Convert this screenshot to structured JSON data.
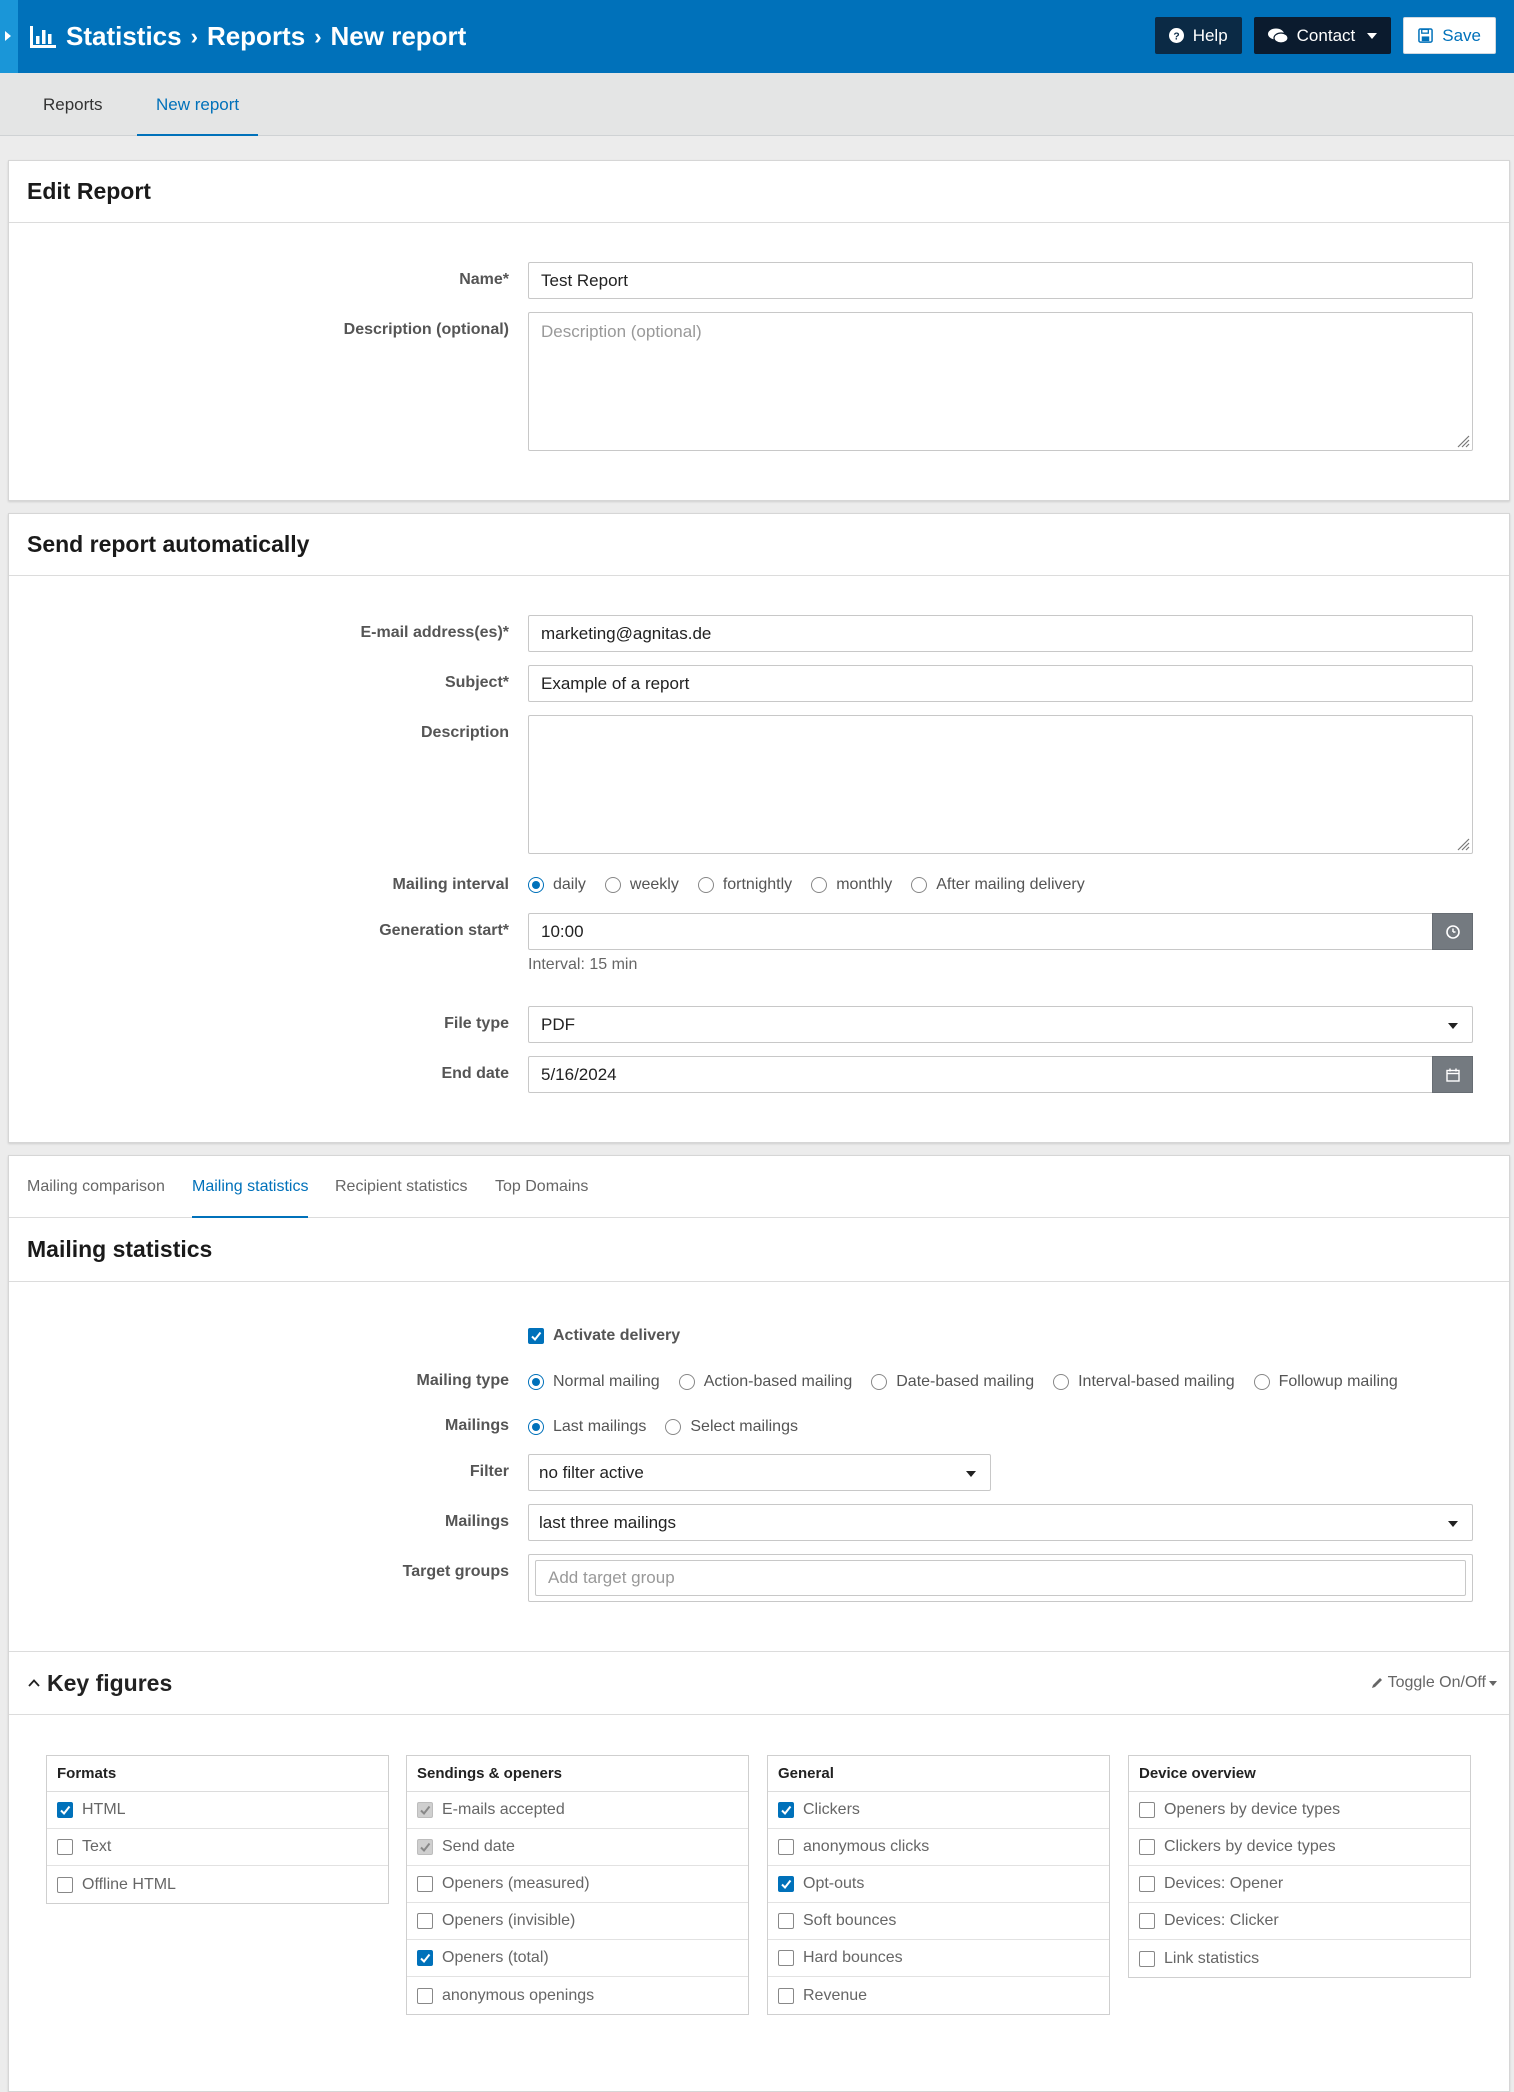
{
  "header": {
    "breadcrumb": [
      "Statistics",
      "Reports",
      "New report"
    ],
    "help_label": "Help",
    "contact_label": "Contact",
    "save_label": "Save"
  },
  "tabs": [
    {
      "label": "Reports",
      "active": false
    },
    {
      "label": "New report",
      "active": true
    }
  ],
  "edit_report": {
    "title": "Edit Report",
    "name_label": "Name*",
    "name_value": "Test Report",
    "description_label": "Description (optional)",
    "description_placeholder": "Description (optional)"
  },
  "send_auto": {
    "title": "Send report automatically",
    "email_label": "E-mail address(es)*",
    "email_value": "marketing@agnitas.de",
    "subject_label": "Subject*",
    "subject_value": "Example of a report",
    "description_label": "Description",
    "description_value": "",
    "interval_label": "Mailing interval",
    "interval_options": [
      "daily",
      "weekly",
      "fortnightly",
      "monthly",
      "After mailing delivery"
    ],
    "interval_selected": "daily",
    "generation_label": "Generation start*",
    "generation_value": "10:00",
    "interval_help": "Interval: 15 min",
    "filetype_label": "File type",
    "filetype_value": "PDF",
    "enddate_label": "End date",
    "enddate_value": "5/16/2024"
  },
  "stats_tabs": [
    {
      "label": "Mailing comparison",
      "active": false
    },
    {
      "label": "Mailing statistics",
      "active": true
    },
    {
      "label": "Recipient statistics",
      "active": false
    },
    {
      "label": "Top Domains",
      "active": false
    }
  ],
  "mailing_stats": {
    "title": "Mailing statistics",
    "activate_label": "Activate delivery",
    "activate_checked": true,
    "type_label": "Mailing type",
    "type_options": [
      "Normal mailing",
      "Action-based mailing",
      "Date-based mailing",
      "Interval-based mailing",
      "Followup mailing"
    ],
    "type_selected": "Normal mailing",
    "mailings_label": "Mailings",
    "mailings_options": [
      "Last mailings",
      "Select mailings"
    ],
    "mailings_selected": "Last mailings",
    "filter_label": "Filter",
    "filter_value": "no filter active",
    "mailings2_label": "Mailings",
    "mailings2_value": "last three mailings",
    "target_label": "Target groups",
    "target_placeholder": "Add target group"
  },
  "key_figures": {
    "title": "Key figures",
    "toggle_label": "Toggle On/Off",
    "groups": [
      {
        "title": "Formats",
        "items": [
          {
            "label": "HTML",
            "state": "checked"
          },
          {
            "label": "Text",
            "state": "unchecked"
          },
          {
            "label": "Offline HTML",
            "state": "unchecked"
          }
        ]
      },
      {
        "title": "Sendings & openers",
        "items": [
          {
            "label": "E-mails accepted",
            "state": "disabled"
          },
          {
            "label": "Send date",
            "state": "disabled"
          },
          {
            "label": "Openers (measured)",
            "state": "unchecked"
          },
          {
            "label": "Openers (invisible)",
            "state": "unchecked"
          },
          {
            "label": "Openers (total)",
            "state": "checked"
          },
          {
            "label": "anonymous openings",
            "state": "unchecked"
          }
        ]
      },
      {
        "title": "General",
        "items": [
          {
            "label": "Clickers",
            "state": "checked"
          },
          {
            "label": "anonymous clicks",
            "state": "unchecked"
          },
          {
            "label": "Opt-outs",
            "state": "checked"
          },
          {
            "label": "Soft bounces",
            "state": "unchecked"
          },
          {
            "label": "Hard bounces",
            "state": "unchecked"
          },
          {
            "label": "Revenue",
            "state": "unchecked"
          }
        ]
      },
      {
        "title": "Device overview",
        "items": [
          {
            "label": "Openers by device types",
            "state": "unchecked"
          },
          {
            "label": "Clickers by device types",
            "state": "unchecked"
          },
          {
            "label": "Devices: Opener",
            "state": "unchecked"
          },
          {
            "label": "Devices: Clicker",
            "state": "unchecked"
          },
          {
            "label": "Link statistics",
            "state": "unchecked"
          }
        ]
      }
    ]
  }
}
